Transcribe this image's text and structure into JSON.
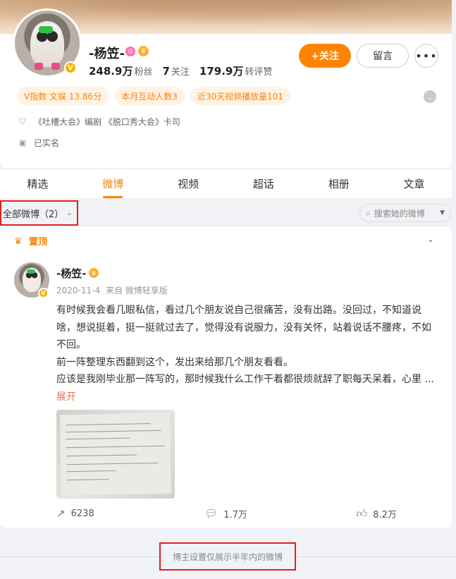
{
  "profile": {
    "name": "-杨笠-",
    "verified_icon": "v-icon",
    "stats": [
      {
        "value": "248.9万",
        "label": "粉丝"
      },
      {
        "value": "7",
        "label": "关注"
      },
      {
        "value": "179.9万",
        "label": "转评赞"
      }
    ],
    "follow_label": "+关注",
    "message_label": "留言",
    "more_label": "•••",
    "tags": [
      "V指数 文娱 13.86分",
      "本月互动人数3",
      "近30天视频播放量101"
    ],
    "info": [
      {
        "icon": "shield-icon",
        "text": "《吐槽大会》编剧 《脱口秀大会》卡司"
      },
      {
        "icon": "id-card-icon",
        "text": "已实名"
      }
    ]
  },
  "tabs": [
    "精选",
    "微博",
    "视频",
    "超话",
    "相册",
    "文章"
  ],
  "active_tab": "微博",
  "filter": {
    "label": "全部微博（2）",
    "search_placeholder": "搜索她的微博"
  },
  "post": {
    "pinned_label": "置顶",
    "author": "-杨笠-",
    "date": "2020-11-4",
    "source": "来自 微博轻享版",
    "paragraphs": [
      "有时候我会看几眼私信，看过几个朋友说自己很痛苦，没有出路。没回过，不知道说啥，想说挺着，挺一挺就过去了，觉得没有说服力，没有关怀，站着说话不腰疼，不如不回。",
      "前一阵整理东西翻到这个，发出来给那几个朋友看看。",
      "应该是我刚毕业那一阵写的，那时候我什么工作干着都很烦就辞了职每天呆着，心里 ..."
    ],
    "expand_label": "展开",
    "reposts": "6238",
    "comments": "1.7万",
    "likes": "8.2万"
  },
  "notice": "博主设置仅展示半年内的微博",
  "colors": {
    "accent": "#ff8200",
    "highlight_border": "#e02020"
  }
}
